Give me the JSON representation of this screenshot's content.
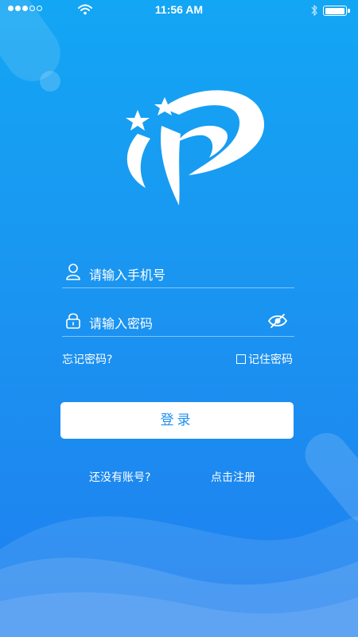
{
  "status_bar": {
    "time": "11:56 AM",
    "signal_bars": 3,
    "signal_total": 5,
    "battery_level": 1.0
  },
  "logo": {
    "icon": "star-swoosh-logo"
  },
  "login_form": {
    "phone_placeholder": "请输入手机号",
    "password_placeholder": "请输入密码",
    "forgot_password": "忘记密码?",
    "remember_password": "记住密码",
    "remember_checked": false,
    "login_button": "登录",
    "no_account": "还没有账号?",
    "register_link": "点击注册"
  },
  "colors": {
    "background_top": "#13a6f4",
    "background_bottom": "#1f7ff0",
    "button_text": "#1e8ff0"
  }
}
